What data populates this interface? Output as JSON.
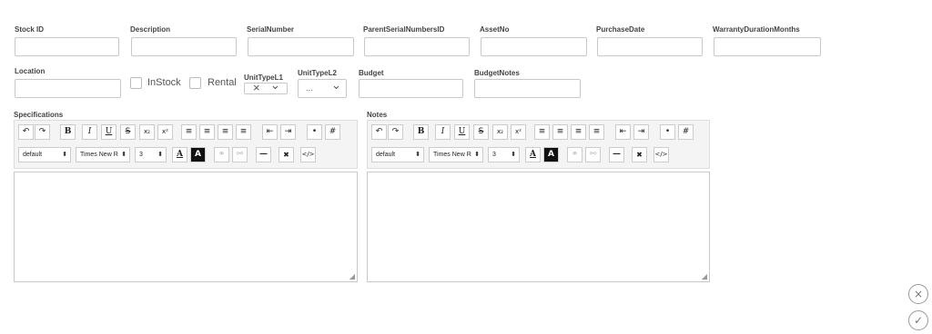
{
  "fields": {
    "stock_id": {
      "label": "Stock ID",
      "value": ""
    },
    "description": {
      "label": "Description",
      "value": ""
    },
    "serial_number": {
      "label": "SerialNumber",
      "value": ""
    },
    "parent_serials": {
      "label": "ParentSerialNumbersID",
      "value": ""
    },
    "asset_no": {
      "label": "AssetNo",
      "value": ""
    },
    "purchase_date": {
      "label": "PurchaseDate",
      "value": ""
    },
    "warranty": {
      "label": "WarrantyDurationMonths",
      "value": ""
    },
    "location": {
      "label": "Location",
      "value": ""
    },
    "budget": {
      "label": "Budget",
      "value": ""
    },
    "budget_notes": {
      "label": "BudgetNotes",
      "value": ""
    }
  },
  "checkboxes": {
    "instock": {
      "label": "InStock",
      "checked": false
    },
    "rental": {
      "label": "Rental",
      "checked": false
    }
  },
  "unit_type1": {
    "label": "UnitTypeL1",
    "value": "",
    "clear_icon": "×",
    "chevron": "⌄"
  },
  "unit_type2": {
    "label": "UnitTypeL2",
    "value": "...",
    "chevron": "⌄"
  },
  "editors": {
    "specifications": {
      "label": "Specifications"
    },
    "notes": {
      "label": "Notes"
    }
  },
  "toolbar": {
    "undo": "↶",
    "redo": "↷",
    "bold": "B",
    "italic": "I",
    "underline": "U",
    "strike": "S",
    "sub": "x₂",
    "sup": "x²",
    "block_dd": "default",
    "font_dd": "Times New R",
    "size_dd": "3",
    "dd_arrow": "⬍",
    "fore_color": "A",
    "back_color": "A",
    "remove": "✖",
    "source": "</>"
  },
  "actions": {
    "cancel": "×",
    "confirm": "✓"
  }
}
